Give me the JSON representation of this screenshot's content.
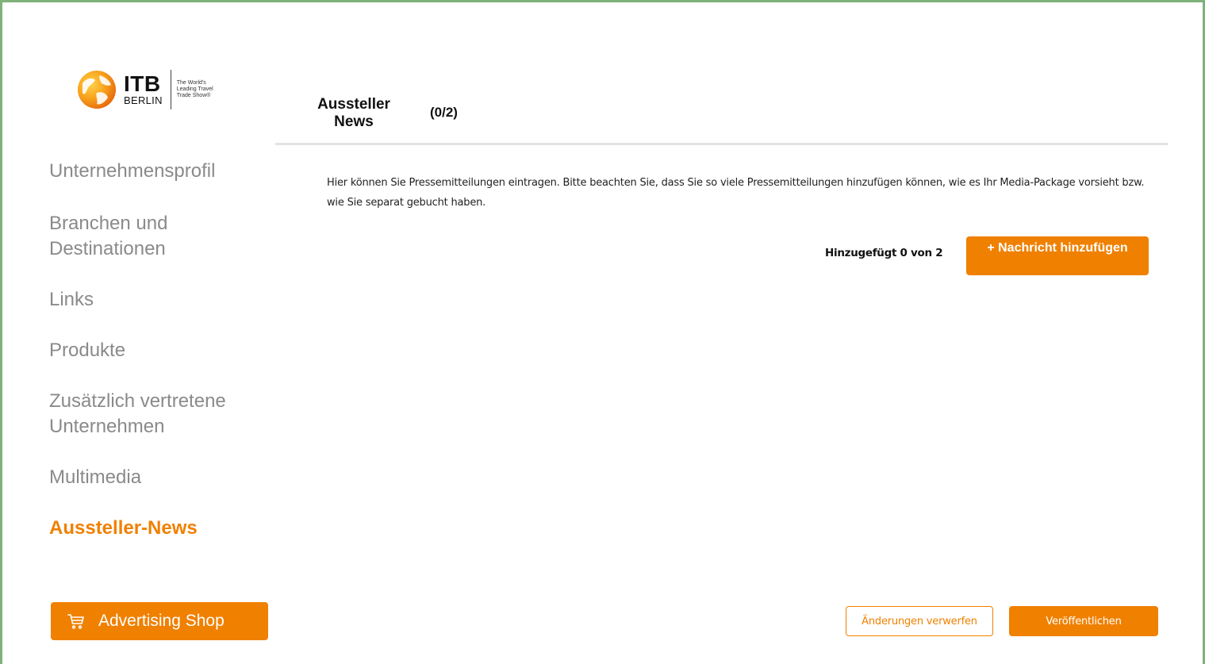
{
  "logo": {
    "brand": "ITB",
    "city": "BERLIN",
    "tagline": "The World's Leading Travel Trade Show®",
    "icon": "globe-icon"
  },
  "sidebar": {
    "items": [
      {
        "label": "Unternehmensprofil",
        "active": false
      },
      {
        "label": "Branchen und Destinationen",
        "active": false
      },
      {
        "label": "Links",
        "active": false
      },
      {
        "label": "Produkte",
        "active": false
      },
      {
        "label": "Zusätzlich vertretene Unternehmen",
        "active": false
      },
      {
        "label": "Multimedia",
        "active": false
      },
      {
        "label": "Aussteller-News",
        "active": true
      }
    ],
    "shop_button": {
      "label": "Advertising Shop",
      "icon": "cart-icon"
    }
  },
  "header": {
    "title": "Aussteller News",
    "count": "(0/2)"
  },
  "main": {
    "description": "Hier können Sie Pressemitteilungen eintragen. Bitte beachten Sie, dass Sie so viele Pressemitteilungen hinzufügen können, wie es Ihr Media-Package vorsieht bzw. wie Sie separat gebucht haben.",
    "added_text": "Hinzugefügt 0 von 2",
    "add_button": "+ Nachricht hinzufügen"
  },
  "footer": {
    "discard_label": "Änderungen verwerfen",
    "publish_label": "Veröffentlichen"
  },
  "colors": {
    "accent": "#f08000",
    "frame": "#7fb27a",
    "nav_inactive": "#8a8a8a"
  }
}
